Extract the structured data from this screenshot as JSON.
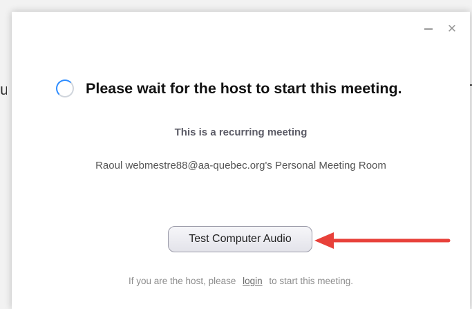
{
  "background": {
    "left_fragment": "u"
  },
  "window": {
    "minimize_icon": "minimize-icon",
    "close_icon": "close-icon",
    "close_glyph": "✕"
  },
  "status": {
    "spinner_icon": "loading-spinner-icon",
    "heading": "Please wait for the host to start this meeting.",
    "subheading": "This is a recurring meeting",
    "room_name": "Raoul webmestre88@aa-quebec.org's Personal Meeting Room"
  },
  "actions": {
    "test_audio_label": "Test Computer Audio"
  },
  "annotation": {
    "arrow_icon": "red-arrow-icon",
    "arrow_color": "#e8413a"
  },
  "footer": {
    "prefix": "If you are the host, please",
    "login_label": "login",
    "suffix": "to start this meeting."
  },
  "colors": {
    "accent": "#2d8cff",
    "heading": "#111111",
    "muted": "#8c8c8c"
  }
}
